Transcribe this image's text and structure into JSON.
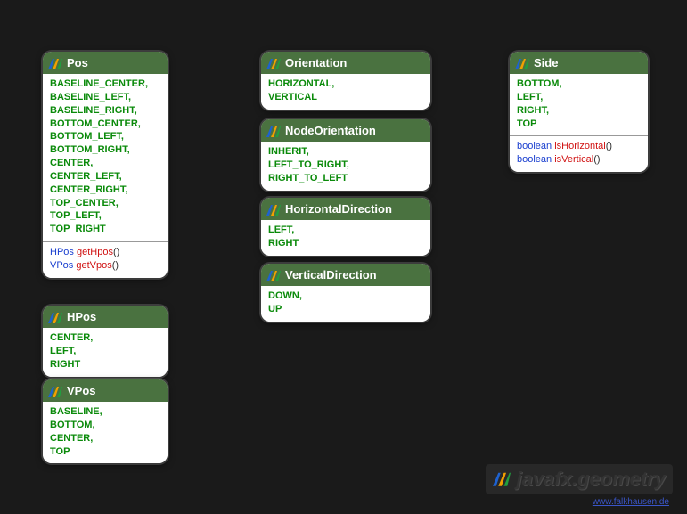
{
  "package_title": "javafx.geometry",
  "credit": "www.falkhausen.de",
  "classes": {
    "pos": {
      "name": "Pos",
      "values": [
        "BASELINE_CENTER,",
        "BASELINE_LEFT,",
        "BASELINE_RIGHT,",
        "BOTTOM_CENTER,",
        "BOTTOM_LEFT,",
        "BOTTOM_RIGHT,",
        "CENTER,",
        "CENTER_LEFT,",
        "CENTER_RIGHT,",
        "TOP_CENTER,",
        "TOP_LEFT,",
        "TOP_RIGHT"
      ],
      "methods": [
        {
          "ret": "HPos",
          "name": "getHpos",
          "parens": "()"
        },
        {
          "ret": "VPos",
          "name": "getVpos",
          "parens": "()"
        }
      ]
    },
    "hpos": {
      "name": "HPos",
      "values": [
        "CENTER,",
        "LEFT,",
        "RIGHT"
      ]
    },
    "vpos": {
      "name": "VPos",
      "values": [
        "BASELINE,",
        "BOTTOM,",
        "CENTER,",
        "TOP"
      ]
    },
    "orientation": {
      "name": "Orientation",
      "values": [
        "HORIZONTAL,",
        "VERTICAL"
      ]
    },
    "nodeorientation": {
      "name": "NodeOrientation",
      "values": [
        "INHERIT,",
        "LEFT_TO_RIGHT,",
        "RIGHT_TO_LEFT"
      ]
    },
    "horizontaldirection": {
      "name": "HorizontalDirection",
      "values": [
        "LEFT,",
        "RIGHT"
      ]
    },
    "verticaldirection": {
      "name": "VerticalDirection",
      "values": [
        "DOWN,",
        "UP"
      ]
    },
    "side": {
      "name": "Side",
      "values": [
        "BOTTOM,",
        "LEFT,",
        "RIGHT,",
        "TOP"
      ],
      "methods": [
        {
          "ret": "boolean",
          "name": "isHorizontal",
          "parens": "()"
        },
        {
          "ret": "boolean",
          "name": "isVertical",
          "parens": "()"
        }
      ]
    }
  }
}
